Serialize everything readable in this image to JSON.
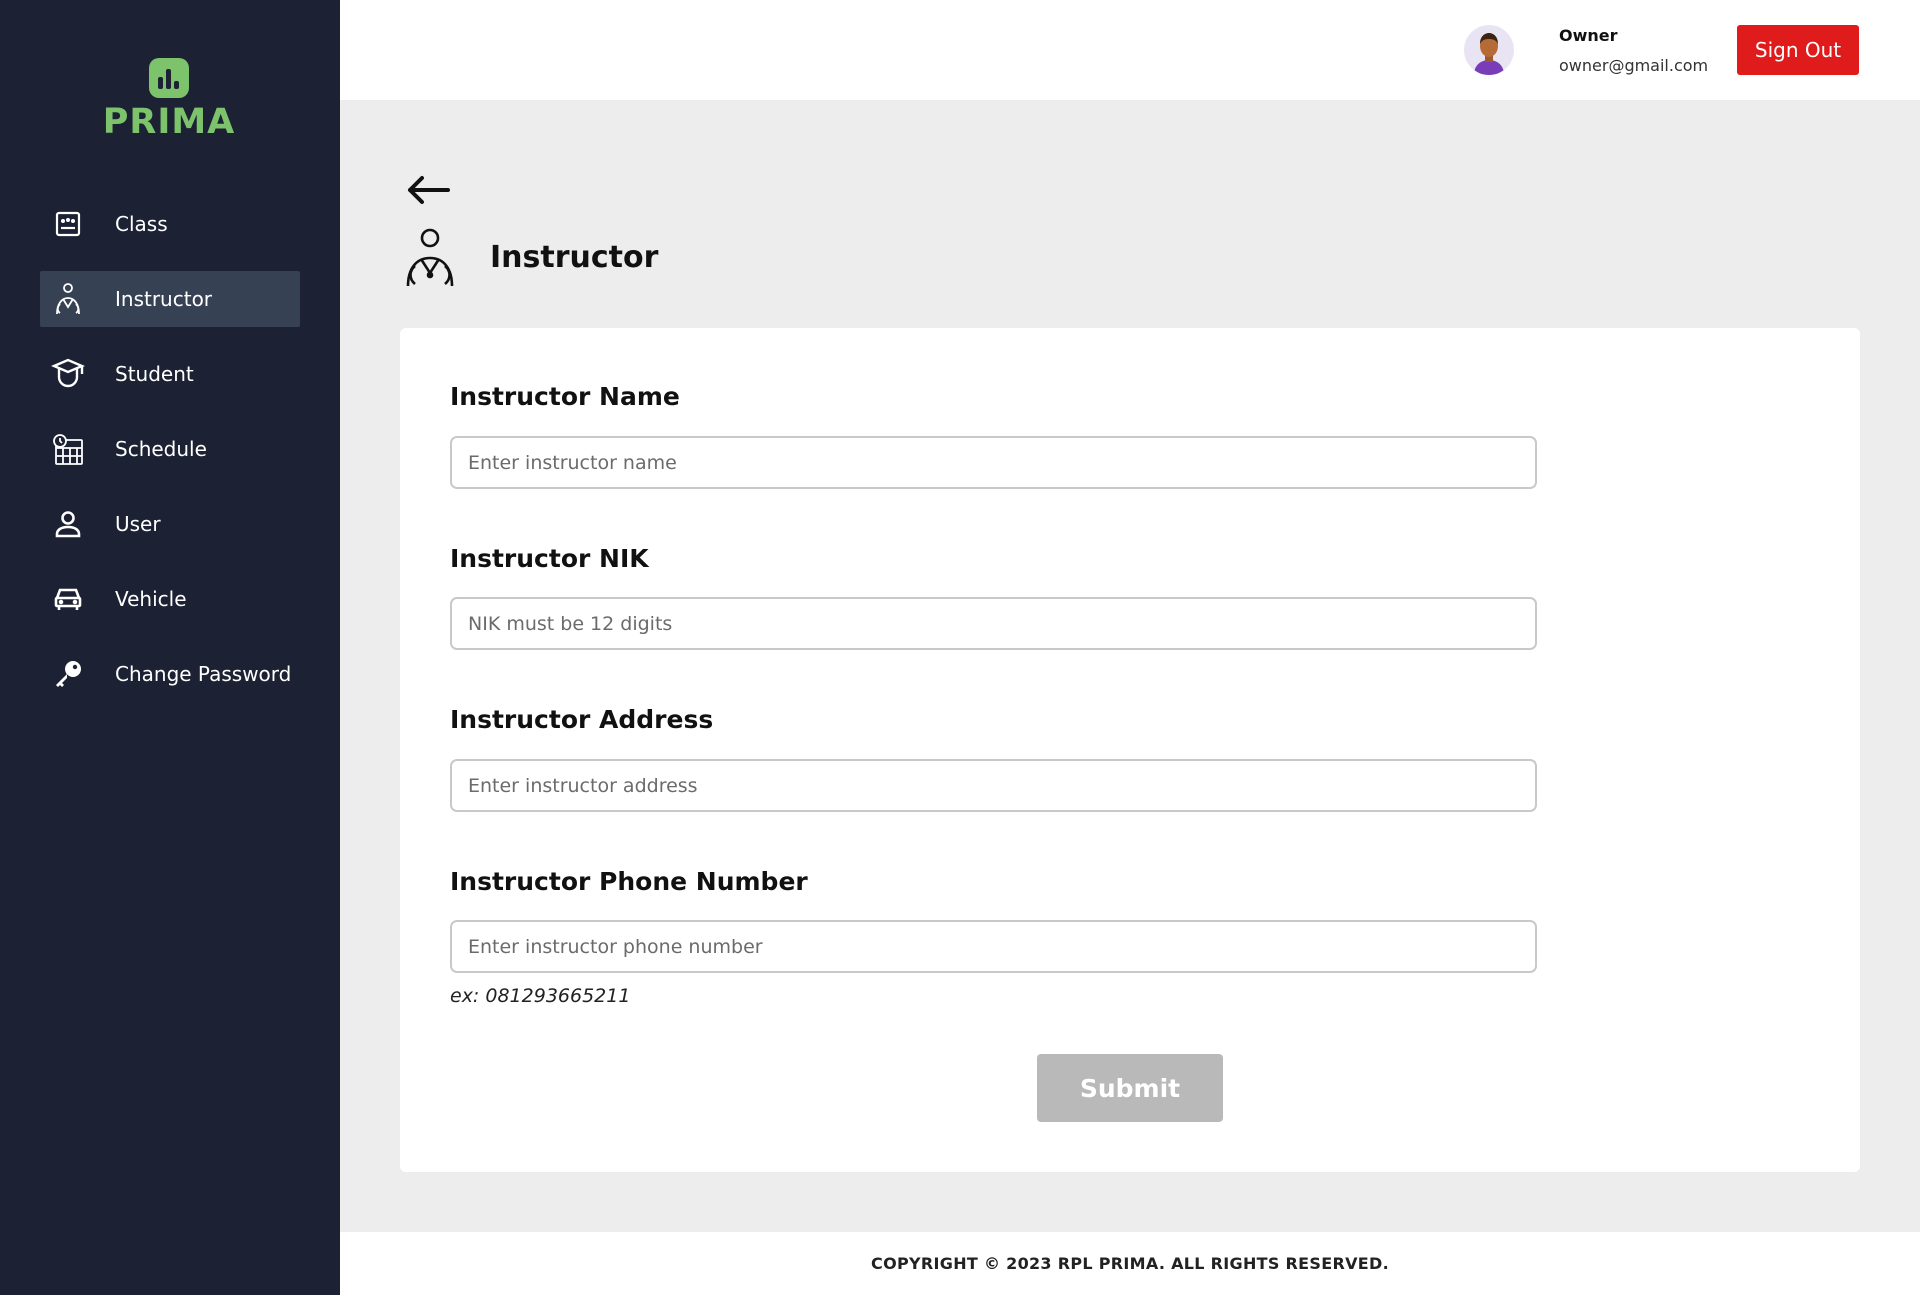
{
  "app": {
    "brand": "PRIMA",
    "brand_color": "#7cc36c"
  },
  "sidebar": {
    "items": [
      {
        "label": "Class",
        "icon": "class-icon",
        "active": false
      },
      {
        "label": "Instructor",
        "icon": "instructor-icon",
        "active": true
      },
      {
        "label": "Student",
        "icon": "student-icon",
        "active": false
      },
      {
        "label": "Schedule",
        "icon": "schedule-icon",
        "active": false
      },
      {
        "label": "User",
        "icon": "user-icon",
        "active": false
      },
      {
        "label": "Vehicle",
        "icon": "vehicle-icon",
        "active": false
      },
      {
        "label": "Change Password",
        "icon": "key-icon",
        "active": false
      }
    ]
  },
  "header": {
    "user_name": "Owner",
    "user_email": "owner@gmail.com",
    "signout_label": "Sign Out",
    "signout_color": "#e01b1b"
  },
  "page": {
    "title": "Instructor"
  },
  "form": {
    "name": {
      "label": "Instructor Name",
      "placeholder": "Enter instructor name",
      "value": ""
    },
    "nik": {
      "label": "Instructor NIK",
      "placeholder": "NIK must be 12 digits",
      "value": ""
    },
    "address": {
      "label": "Instructor Address",
      "placeholder": "Enter instructor address",
      "value": ""
    },
    "phone": {
      "label": "Instructor Phone Number",
      "placeholder": "Enter instructor phone number",
      "value": "",
      "hint": "ex: 081293665211"
    },
    "submit_label": "Submit"
  },
  "footer": {
    "text": "COPYRIGHT © 2023 RPL PRIMA. ALL RIGHTS RESERVED."
  }
}
